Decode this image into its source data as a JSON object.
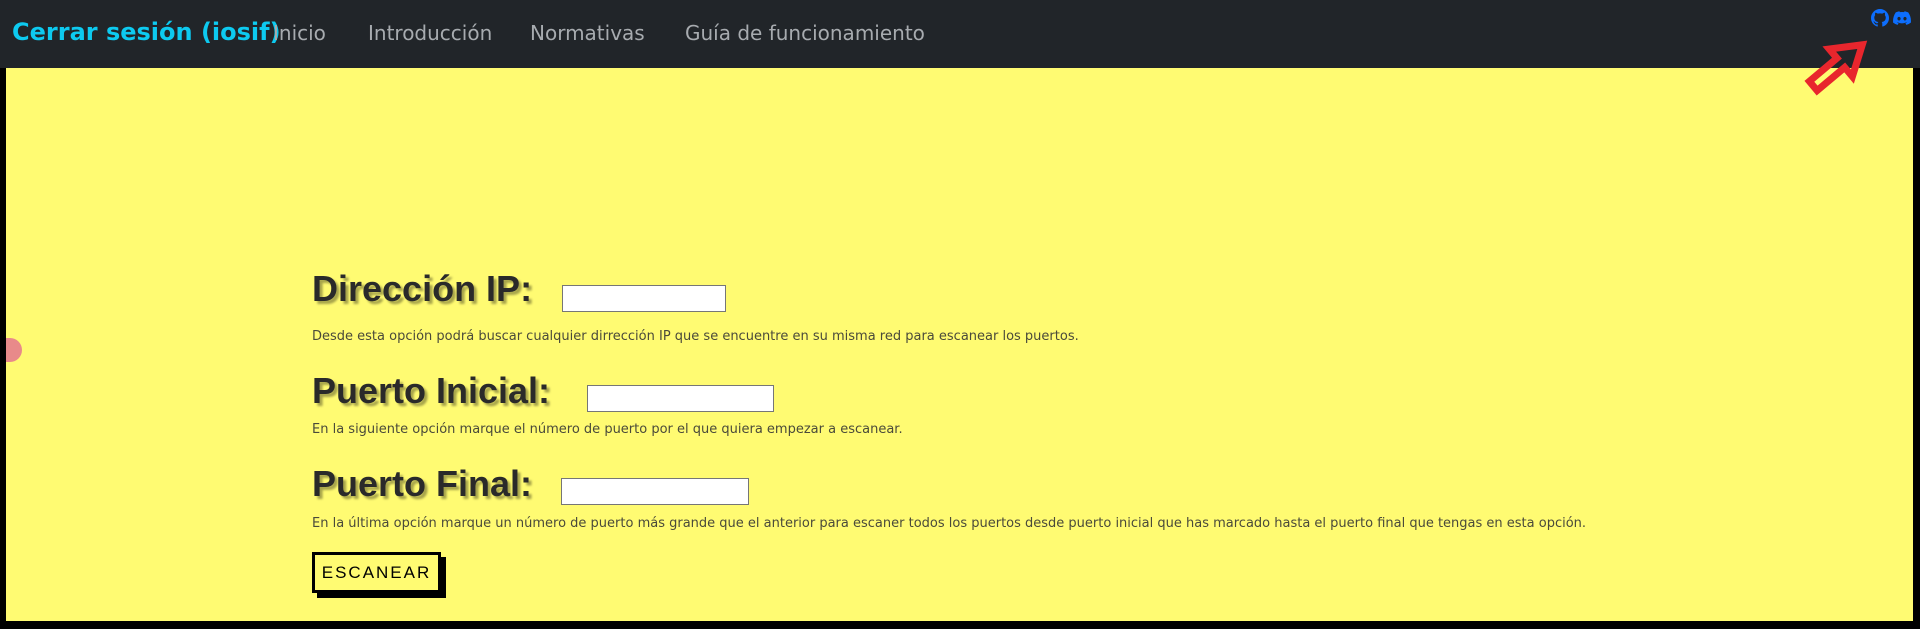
{
  "navbar": {
    "brand": "Cerrar sesión (iosif)",
    "links": [
      {
        "label": "Inicio"
      },
      {
        "label": "Introducción"
      },
      {
        "label": "Normativas"
      },
      {
        "label": "Guía de funcionamiento"
      }
    ],
    "social_icons": [
      "github-icon",
      "discord-icon"
    ]
  },
  "form": {
    "ip": {
      "label": "Dirección IP:",
      "value": "",
      "description": "Desde esta opción podrá buscar cualquier dirrección IP que se encuentre en su misma red para escanear los puertos."
    },
    "start_port": {
      "label": "Puerto Inicial:",
      "value": "",
      "description": "En la siguiente opción marque el número de puerto por el que quiera empezar a escanear."
    },
    "end_port": {
      "label": "Puerto Final:",
      "value": "",
      "description": "En la última opción marque un número de puerto más grande que el anterior para escaner todos los puertos desde puerto inicial que has marcado hasta el puerto final que tengas en esta opción."
    },
    "submit_label": "ESCANEAR"
  },
  "colors": {
    "navbar_bg": "#212529",
    "brand": "#0dcaf0",
    "nav_link": "#a7abaf",
    "content_bg": "#fffb72",
    "social_icon": "#0d6efd",
    "arrow": "#e8262d"
  }
}
